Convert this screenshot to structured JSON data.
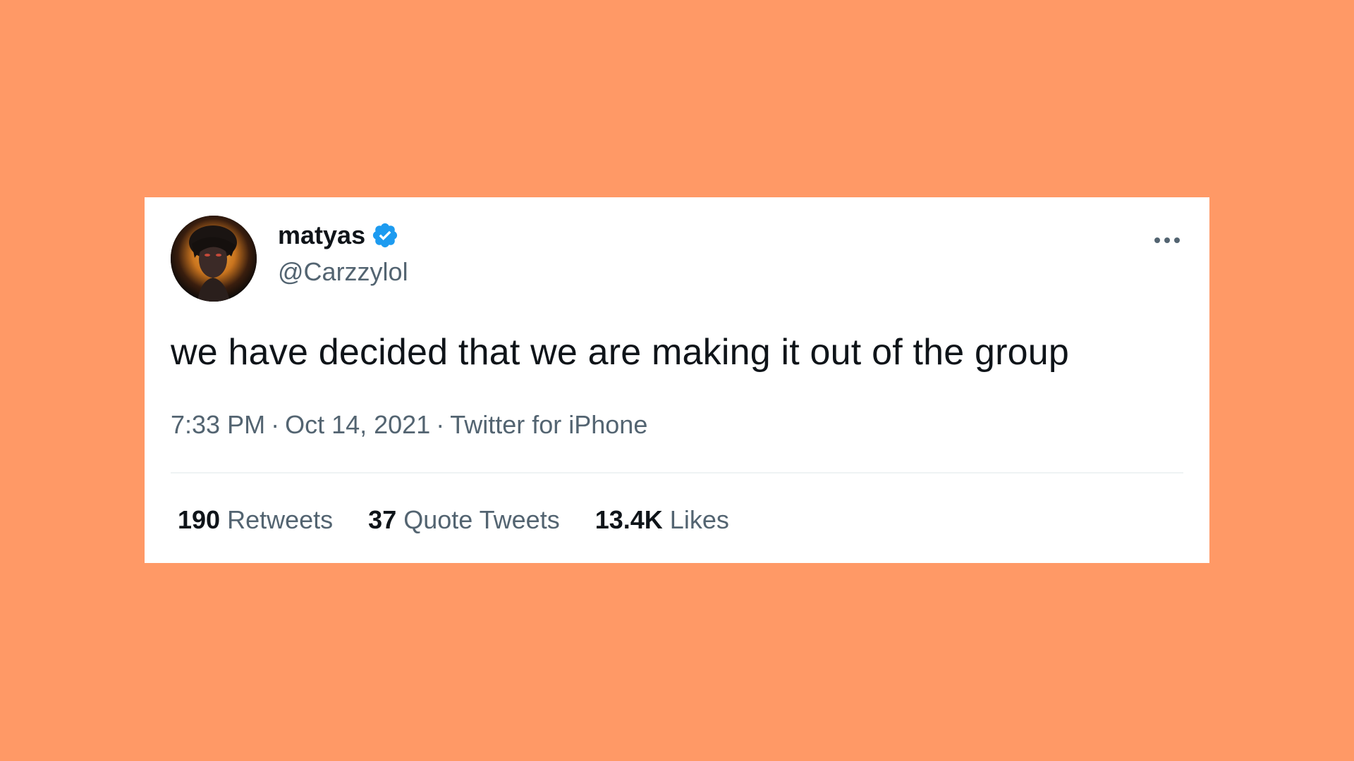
{
  "colors": {
    "background": "#FF9966",
    "card": "#FFFFFF",
    "text_primary": "#0F1419",
    "text_secondary": "#536471",
    "verified_blue": "#1D9BF0"
  },
  "author": {
    "name": "matyas",
    "handle": "@Carzzylol",
    "verified_icon": "verified-badge-icon",
    "avatar": "avatar-image"
  },
  "more_icon": "more-horizontal-icon",
  "tweet": {
    "text": "we have decided that we are making it out of the group"
  },
  "meta": {
    "time": "7:33 PM",
    "separator": "·",
    "date": "Oct 14, 2021",
    "source": "Twitter for iPhone"
  },
  "stats": {
    "retweets": {
      "count": "190",
      "label": "Retweets"
    },
    "quote_tweets": {
      "count": "37",
      "label": "Quote Tweets"
    },
    "likes": {
      "count": "13.4K",
      "label": "Likes"
    }
  }
}
